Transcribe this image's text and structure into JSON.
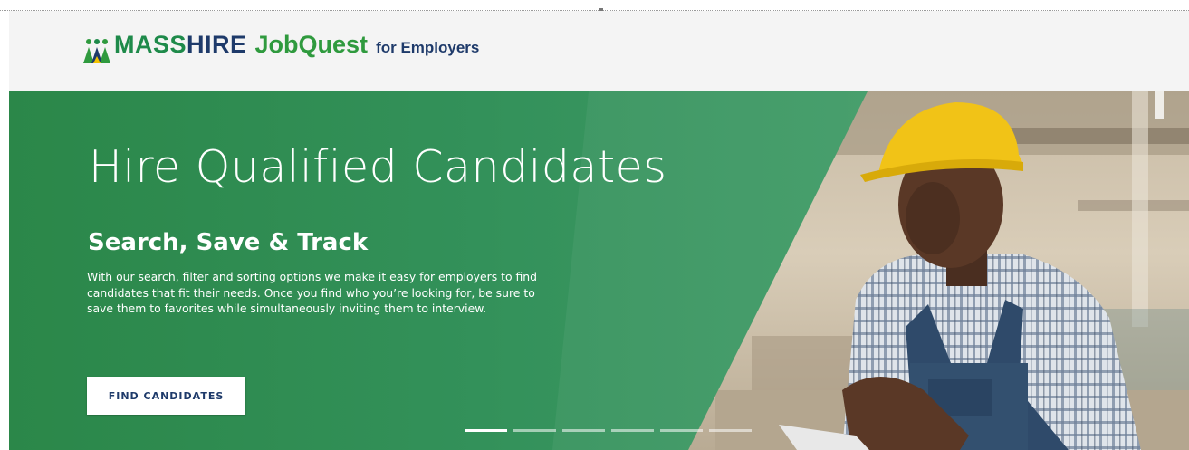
{
  "brand": {
    "mass": "MASS",
    "hire": "HIRE",
    "jobquest": "JobQuest",
    "for_employers": "for Employers",
    "icon": "people-figures-icon",
    "colors": {
      "mass": "#1e8a4a",
      "hire": "#1e3a6a",
      "jobquest": "#2f9a3e"
    }
  },
  "hero": {
    "title": "Hire Qualified Candidates",
    "subtitle": "Search, Save & Track",
    "description": "With our search, filter and sorting options we make it easy for employers to find candidates that fit their needs. Once you find who you’re looking for, be sure to save them to favorites while simultaneously inviting them to interview.",
    "cta_label": "FIND CANDIDATES",
    "background_color": "#2f8a4e",
    "image": "construction-worker-photo"
  },
  "carousel": {
    "slide_count": 6,
    "active_index": 0
  }
}
